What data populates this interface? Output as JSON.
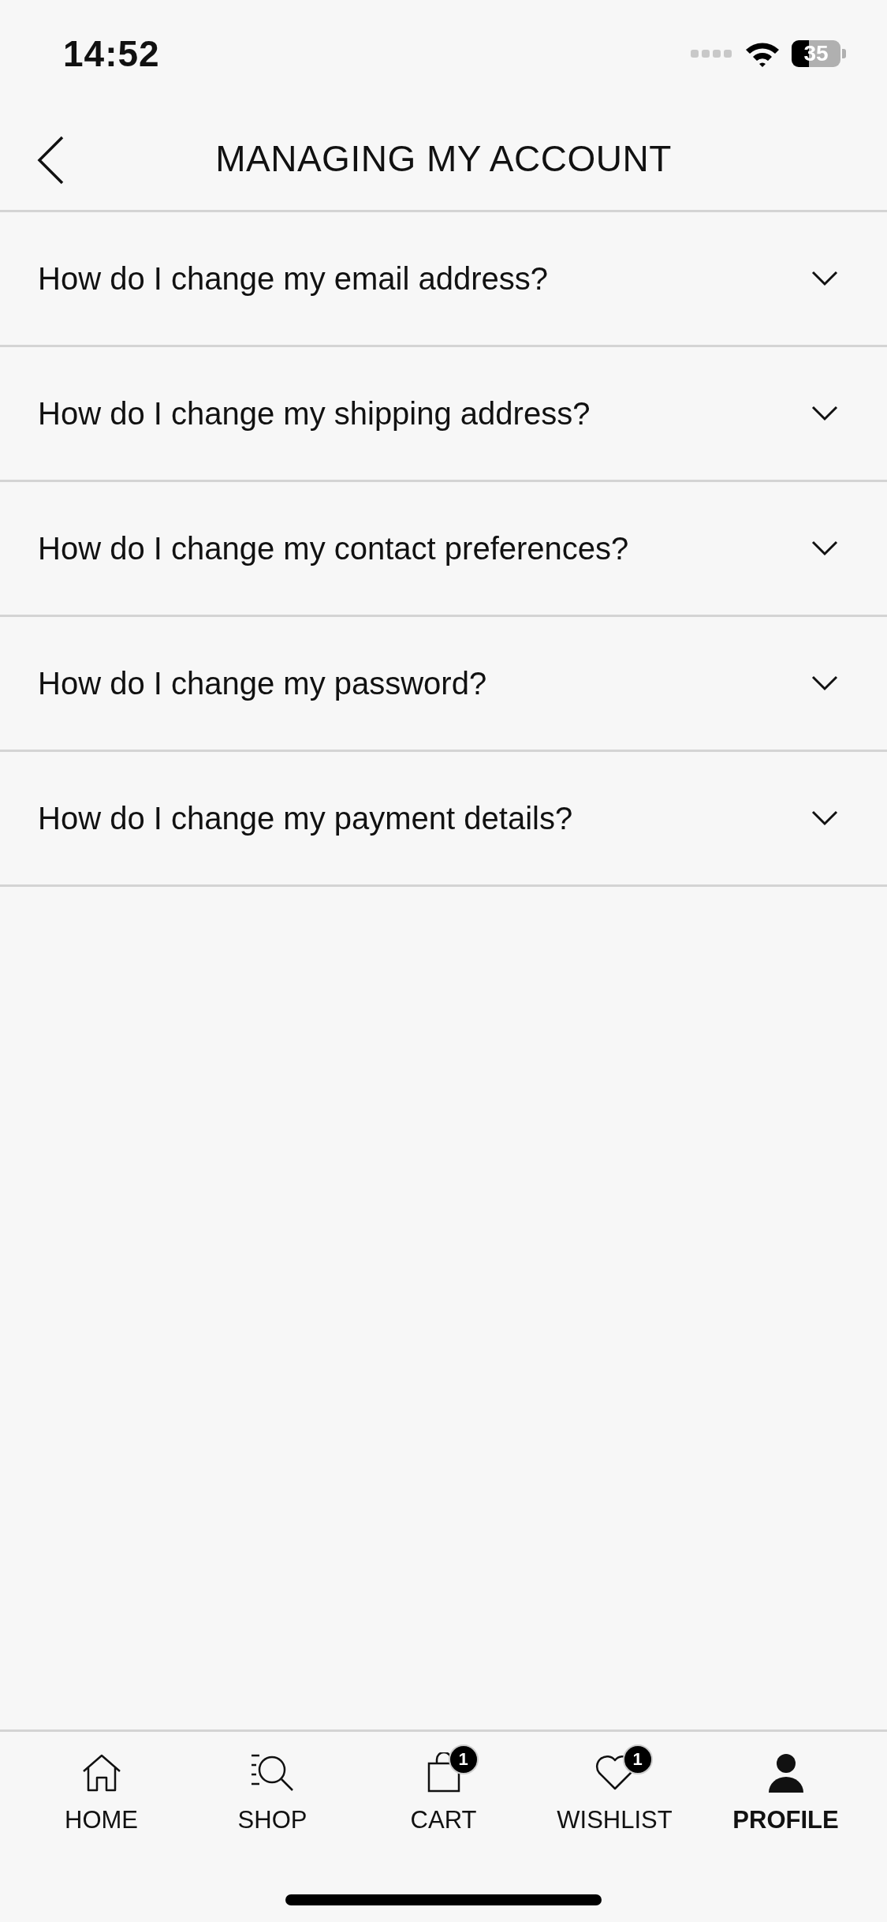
{
  "status_bar": {
    "time": "14:52",
    "battery": "35"
  },
  "header": {
    "title": "MANAGING MY ACCOUNT"
  },
  "faq": [
    {
      "question": "How do I change my email address?",
      "expanded": false
    },
    {
      "question": "How do I change my shipping address?",
      "expanded": false
    },
    {
      "question": "How do I change my contact preferences?",
      "expanded": false
    },
    {
      "question": "How do I change my password?",
      "expanded": false
    },
    {
      "question": "How do I change my payment details?",
      "expanded": false
    }
  ],
  "tab_bar": [
    {
      "kind": "home",
      "label": "HOME",
      "selected": false
    },
    {
      "kind": "shop",
      "label": "SHOP",
      "selected": false
    },
    {
      "kind": "cart",
      "label": "CART",
      "selected": false,
      "badge": "1"
    },
    {
      "kind": "wishlist",
      "label": "WISHLIST",
      "selected": false,
      "badge": "1"
    },
    {
      "kind": "profile",
      "label": "PROFILE",
      "selected": true
    }
  ]
}
